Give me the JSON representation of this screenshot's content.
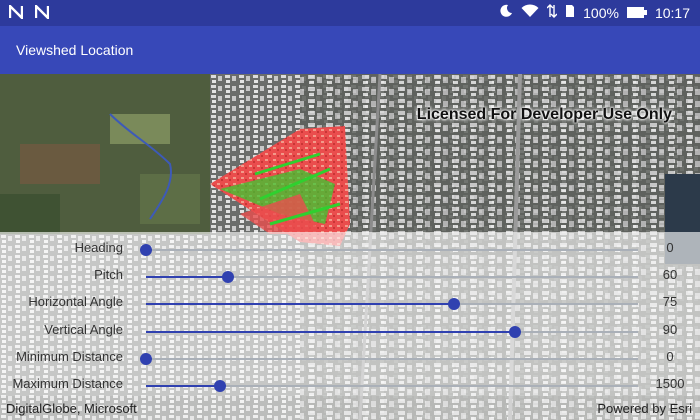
{
  "status_bar": {
    "left_icons": [
      "N",
      "N"
    ],
    "battery": "100%",
    "time": "10:17",
    "icons": [
      "moon-icon",
      "wifi-icon",
      "data-icon",
      "battery-icon"
    ]
  },
  "app_bar": {
    "title": "Viewshed Location"
  },
  "map": {
    "license_text": "Licensed For Developer Use Only",
    "attribution": "DigitalGlobe, Microsoft",
    "powered_by": "Powered by Esri"
  },
  "controls": [
    {
      "label": "Heading",
      "value": "0",
      "level": 0.0
    },
    {
      "label": "Pitch",
      "value": "60",
      "level": 0.167
    },
    {
      "label": "Horizontal Angle",
      "value": "75",
      "level": 0.625
    },
    {
      "label": "Vertical Angle",
      "value": "90",
      "level": 0.75
    },
    {
      "label": "Minimum Distance",
      "value": "0",
      "level": 0.0
    },
    {
      "label": "Maximum Distance",
      "value": "1500",
      "level": 0.15
    }
  ],
  "colors": {
    "status_bar": "#2d3a9c",
    "app_bar": "#3748b8",
    "accent": "#3041b0",
    "viewshed_visible": "#2fd02f",
    "viewshed_hidden": "#e83b3b"
  }
}
